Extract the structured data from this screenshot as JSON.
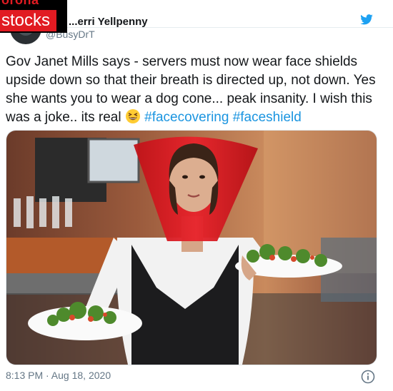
{
  "overlay": {
    "line1": "orona",
    "line2": "stocks"
  },
  "author": {
    "display_name": "...erri Yellpenny",
    "handle": "@BusyDrT"
  },
  "tweet": {
    "text_main": "Gov Janet Mills says - servers must now wear face shields upside down so that their breath is directed up, not down. Yes she wants you to wear a dog cone... peak insanity.  I wish this was a joke.. its real ",
    "emoji": "grinning-squinting-face",
    "hashtags": [
      "#facecovering",
      "#faceshield"
    ],
    "timestamp": "8:13 PM · Aug 18, 2020"
  },
  "icons": {
    "bird": "twitter-bird-icon",
    "info": "info-icon"
  },
  "colors": {
    "link": "#1b95e0",
    "text": "#14171a",
    "muted": "#657786",
    "badge_red": "#e11b22"
  }
}
